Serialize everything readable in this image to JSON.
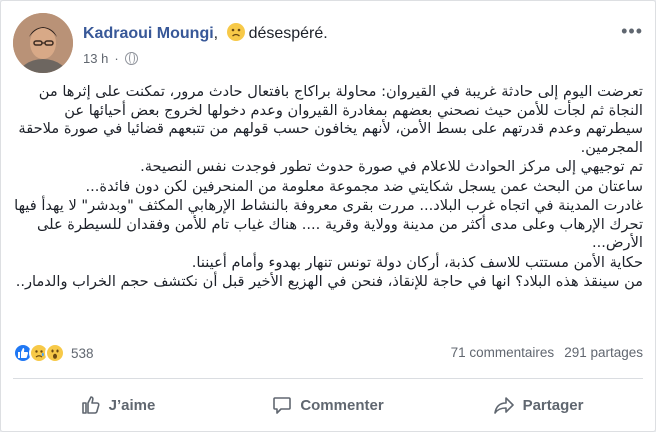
{
  "post": {
    "author": "Kadraoui Moungi",
    "feeling": "désespéré.",
    "time": "13 h",
    "more_label": "•••",
    "paragraphs": [
      "تعرضت اليوم إلى حادثة غريبة في القيروان: محاولة براكاج بافتعال حادث مرور، تمكنت على إثرها من النجاة ثم لجأت للأمن حيث نصحني بعضهم بمغادرة القيروان وعدم دخولها لخروج بعض أحيائها عن سيطرتهم وعدم قدرتهم على بسط الأمن، لأنهم يخافون حسب قولهم من تتبعهم قضائيا في صورة ملاحقة المجرمين.",
      "تم توجيهي إلى مركز الحوادث للاعلام في صورة حدوث تطور فوجدت نفس النصيحة.",
      "ساعتان من البحث عمن يسجل شكايتي ضد مجموعة معلومة من المنحرفين لكن دون فائدة...",
      "غادرت المدينة في اتجاه غرب البلاد... مررت بقرى معروفة بالنشاط الإرهابي المكثف \"وبدشر\" لا يهدأ فيها تحرك الإرهاب وعلى مدى أكثر من مدينة وولاية وقرية .... هناك غياب تام للأمن وفقدان للسيطرة على الأرض...",
      "حكاية الأمن مستتب للاسف كذبة، أركان دولة تونس تنهار بهدوء وأمام أعيننا.",
      "من سينقذ هذه البلاد؟ انها في حاجة للإنقاذ، فنحن في الهزيع الأخير قبل أن نكتشف حجم الخراب والدمار.."
    ]
  },
  "stats": {
    "reaction_icons": [
      "like-icon",
      "sad-icon",
      "wow-icon"
    ],
    "reaction_count": "538",
    "comments": "71 commentaires",
    "shares": "291 partages"
  },
  "actions": {
    "like": "J’aime",
    "comment": "Commenter",
    "share": "Partager"
  },
  "colors": {
    "author": "#385898",
    "like_blue": "#2078f4",
    "emoji_yellow": "#f7c948",
    "muted": "#616770"
  }
}
